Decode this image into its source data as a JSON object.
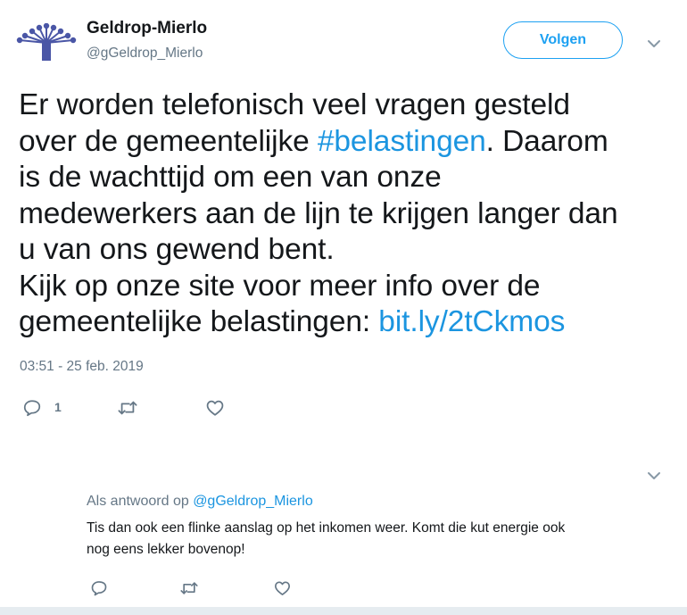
{
  "colors": {
    "accent": "#1da1f2",
    "link": "#1b95e0",
    "muted": "#657786",
    "text": "#14171a",
    "logo": "#4a56a6"
  },
  "header": {
    "display_name": "Geldrop-Mierlo",
    "handle": "@gGeldrop_Mierlo",
    "follow_label": "Volgen",
    "avatar_icon": "tree-logo-icon",
    "menu_icon": "chevron-down-icon"
  },
  "tweet": {
    "line1": "Er worden telefonisch veel vragen gesteld",
    "line2_pre": "over de gemeentelijke ",
    "line2_hashtag": "#belastingen",
    "line2_post": ". Daarom",
    "line3": "is de wachttijd om een van onze",
    "line4": "medewerkers aan de lijn te krijgen langer dan",
    "line5": "u van ons gewend bent.",
    "line6": "Kijk op onze site voor meer info over de",
    "line7_pre": "gemeentelijke belastingen: ",
    "line7_link": "bit.ly/2tCkmos",
    "timestamp": "03:51 - 25 feb. 2019",
    "actions": {
      "reply_count": "1",
      "reply_icon": "reply-icon",
      "retweet_icon": "retweet-icon",
      "like_icon": "heart-icon"
    }
  },
  "reply": {
    "context_prefix": "Als antwoord op ",
    "context_handle": "@gGeldrop_Mierlo",
    "text_line1": "Tis dan ook een flinke aanslag op het inkomen weer. Komt die kut energie ook",
    "text_line2": "nog eens lekker bovenop!",
    "menu_icon": "chevron-down-icon"
  }
}
